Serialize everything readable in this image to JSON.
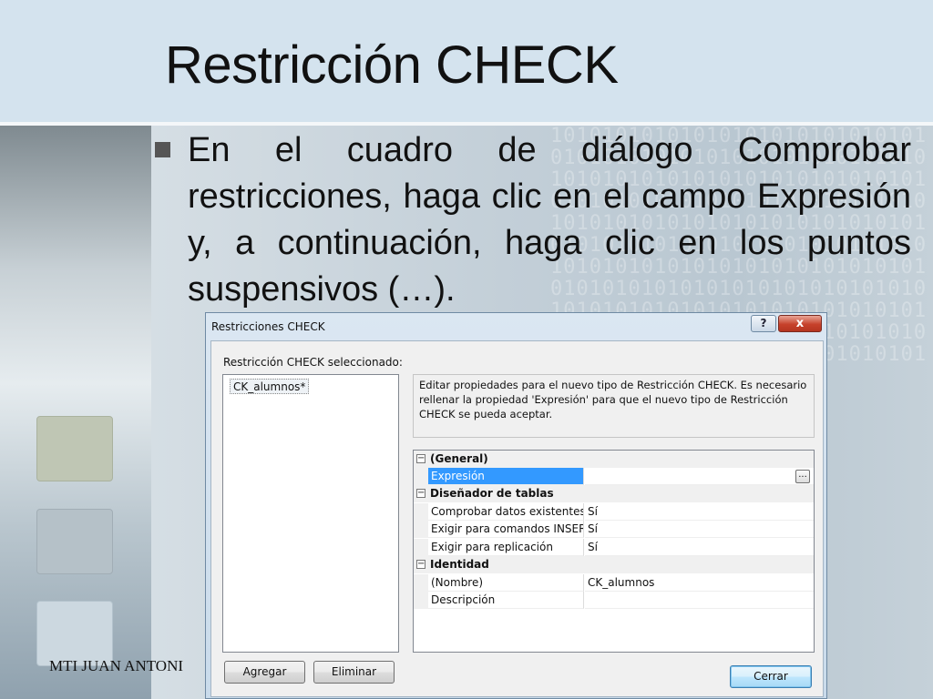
{
  "slide": {
    "title": "Restricción CHECK",
    "bullet": "En el cuadro de diálogo Comprobar restricciones, haga clic en el campo Expresión y, a continuación, haga clic en los puntos suspensivos (…).",
    "footer": "MTI JUAN ANTONI",
    "background_binary": "1010101010101010101010101010101010101010101010101010101010101010101010101010101010101010101010101010101010101010101010101010101010101010101010101010101010101010101010101010101010101010101010101010101010101010101010101010101010101010101010101010101010101010101010101010101010101010101010101010101010101010101010101010101010101010"
  },
  "dialog": {
    "title": "Restricciones CHECK",
    "help_label": "?",
    "close_label": "x",
    "selected_label": "Restricción CHECK seleccionado:",
    "constraints": [
      "CK_alumnos*"
    ],
    "info": "Editar propiedades para el nuevo tipo de Restricción CHECK.  Es necesario rellenar la propiedad 'Expresión' para que el nuevo tipo de Restricción CHECK se pueda aceptar.",
    "properties": {
      "general": {
        "label": "(General)",
        "toggle": "−",
        "expresion": {
          "name": "Expresión",
          "value": "",
          "button": "..."
        }
      },
      "disenador": {
        "label": "Diseñador de tablas",
        "toggle": "−",
        "comprobar": {
          "name": "Comprobar datos existentes al",
          "value": "Sí"
        },
        "exigir_insert": {
          "name": "Exigir para comandos INSERT y",
          "value": "Sí"
        },
        "exigir_replicacion": {
          "name": "Exigir para replicación",
          "value": "Sí"
        }
      },
      "identidad": {
        "label": "Identidad",
        "toggle": "−",
        "nombre": {
          "name": "(Nombre)",
          "value": "CK_alumnos"
        },
        "descripcion": {
          "name": "Descripción",
          "value": ""
        }
      }
    },
    "buttons": {
      "add": "Agregar",
      "delete": "Eliminar",
      "close": "Cerrar"
    }
  }
}
